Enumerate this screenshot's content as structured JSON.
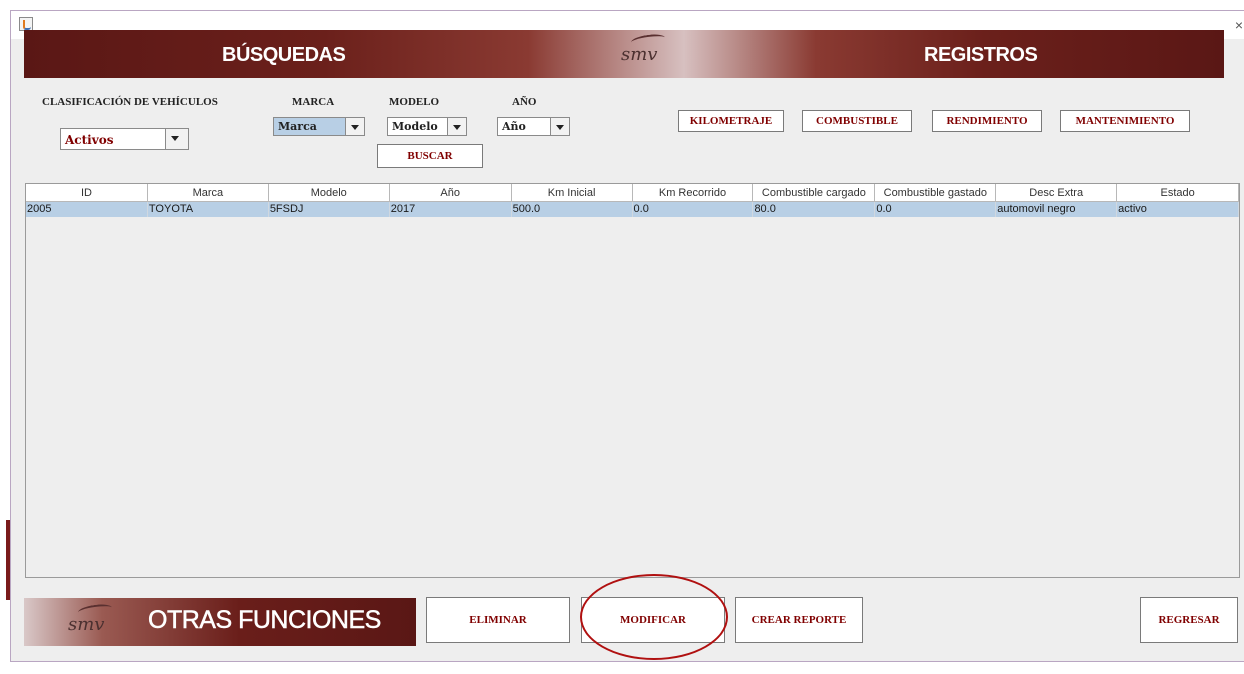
{
  "window": {
    "close_glyph": "×"
  },
  "banner": {
    "left_title": "BÚSQUEDAS",
    "right_title": "REGISTROS",
    "logo_text": "SMV"
  },
  "filters": {
    "classification_label": "CLASIFICACIÓN DE VEHÍCULOS",
    "classification_value": "Activos",
    "brand_label": "MARCA",
    "brand_value": "Marca",
    "model_label": "MODELO",
    "model_value": "Modelo",
    "year_label": "AÑO",
    "year_value": "Año",
    "search_button": "BUSCAR"
  },
  "records_buttons": [
    "KILOMETRAJE",
    "COMBUSTIBLE",
    "RENDIMIENTO",
    "MANTENIMIENTO"
  ],
  "table": {
    "columns": [
      "ID",
      "Marca",
      "Modelo",
      "Año",
      "Km Inicial",
      "Km Recorrido",
      "Combustible cargado",
      "Combustible gastado",
      "Desc Extra",
      "Estado"
    ],
    "rows": [
      [
        "2005",
        "TOYOTA",
        "5FSDJ",
        "2017",
        "500.0",
        "0.0",
        "80.0",
        "0.0",
        "automovil negro",
        "activo"
      ]
    ]
  },
  "footer": {
    "title": "OTRAS FUNCIONES",
    "logo_text": "SMV",
    "delete_button": "ELIMINAR",
    "modify_button": "MODIFICAR",
    "report_button": "CREAR REPORTE",
    "back_button": "REGRESAR"
  },
  "colors": {
    "accent": "#800000",
    "banner_dark": "#5a1715",
    "selection": "#b8cfe5",
    "annotation": "#b01010"
  }
}
